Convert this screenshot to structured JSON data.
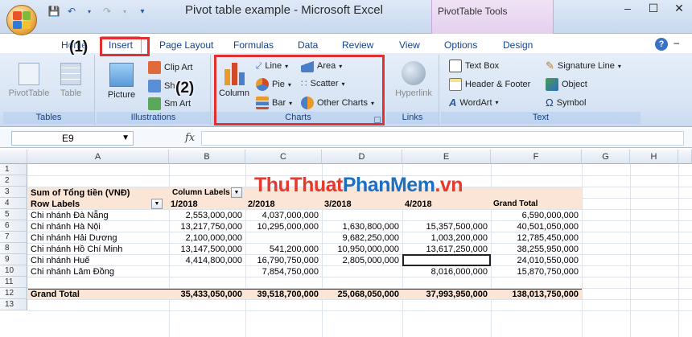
{
  "window": {
    "title": "Pivot table example - Microsoft Excel",
    "contextual_tools": "PivotTable Tools"
  },
  "tabs": [
    {
      "label": "Home"
    },
    {
      "label": "Insert"
    },
    {
      "label": "Page Layout"
    },
    {
      "label": "Formulas"
    },
    {
      "label": "Data"
    },
    {
      "label": "Review"
    },
    {
      "label": "View"
    },
    {
      "label": "Options"
    },
    {
      "label": "Design"
    }
  ],
  "ribbon": {
    "tables": {
      "label": "Tables",
      "pivot": "PivotTable",
      "table": "Table"
    },
    "illustrations": {
      "label": "Illustrations",
      "picture": "Picture",
      "clipart": "Clip Art",
      "shapes": "Sh",
      "smartart": "Sm   Art"
    },
    "charts": {
      "label": "Charts",
      "column": "Column",
      "line": "Line",
      "pie": "Pie",
      "bar": "Bar",
      "area": "Area",
      "scatter": "Scatter",
      "other": "Other Charts"
    },
    "links": {
      "label": "Links",
      "hyperlink": "Hyperlink"
    },
    "text": {
      "label": "Text",
      "textbox": "Text Box",
      "headerfooter": "Header & Footer",
      "wordart": "WordArt",
      "signature": "Signature Line",
      "object": "Object",
      "symbol": "Symbol"
    }
  },
  "annotations": {
    "step1": "(1)",
    "step2": "(2)"
  },
  "formula_bar": {
    "name_box": "E9",
    "fx": "fx",
    "formula": ""
  },
  "columns": [
    "A",
    "B",
    "C",
    "D",
    "E",
    "F",
    "G",
    "H"
  ],
  "rows": [
    "1",
    "2",
    "3",
    "4",
    "5",
    "6",
    "7",
    "8",
    "9",
    "10",
    "11",
    "12",
    "13"
  ],
  "watermark": {
    "part1": "ThuThuat",
    "part2": "PhanMem",
    "part3": ".vn"
  },
  "pivot": {
    "value_field": "Sum of Tổng tiền (VNĐ)",
    "column_labels": "Column Labels",
    "row_labels": "Row Labels",
    "col_headers": [
      "1/2018",
      "2/2018",
      "3/2018",
      "4/2018",
      "Grand Total"
    ],
    "body": [
      {
        "name": "Chi nhánh Đà Nẵng",
        "v": [
          "2,553,000,000",
          "4,037,000,000",
          "",
          "",
          "6,590,000,000"
        ]
      },
      {
        "name": "Chi nhánh Hà Nội",
        "v": [
          "13,217,750,000",
          "10,295,000,000",
          "1,630,800,000",
          "15,357,500,000",
          "40,501,050,000"
        ]
      },
      {
        "name": "Chi nhánh Hải Dương",
        "v": [
          "2,100,000,000",
          "",
          "9,682,250,000",
          "1,003,200,000",
          "12,785,450,000"
        ]
      },
      {
        "name": "Chi nhánh Hồ Chí Minh",
        "v": [
          "13,147,500,000",
          "541,200,000",
          "10,950,000,000",
          "13,617,250,000",
          "38,255,950,000"
        ]
      },
      {
        "name": "Chi nhánh Huế",
        "v": [
          "4,414,800,000",
          "16,790,750,000",
          "2,805,000,000",
          "",
          "24,010,550,000"
        ]
      },
      {
        "name": "Chi nhánh Lâm Đồng",
        "v": [
          "",
          "7,854,750,000",
          "",
          "8,016,000,000",
          "15,870,750,000"
        ]
      }
    ],
    "grand_total": {
      "name": "Grand Total",
      "v": [
        "35,433,050,000",
        "39,518,700,000",
        "25,068,050,000",
        "37,993,950,000",
        "138,013,750,000"
      ]
    }
  }
}
